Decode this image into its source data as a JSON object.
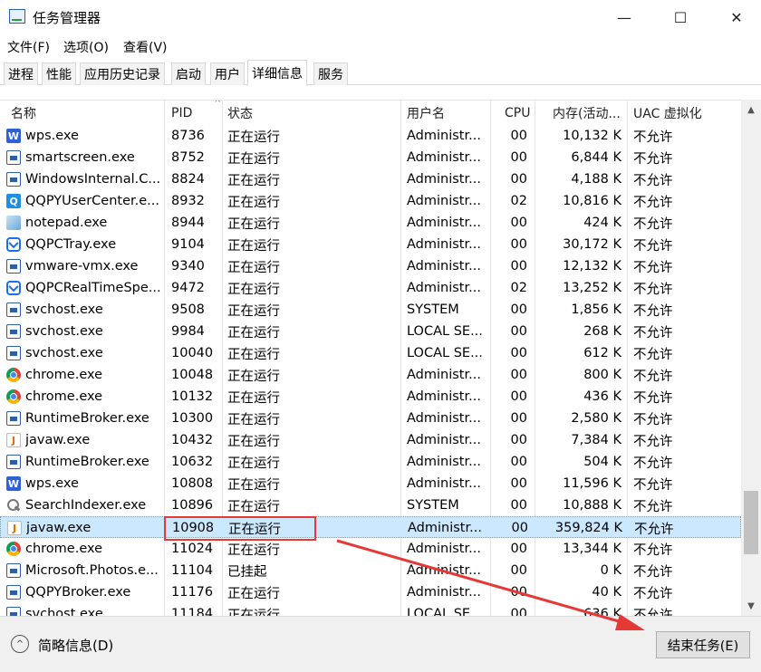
{
  "window": {
    "title": "任务管理器",
    "min": "—",
    "max": "☐",
    "close": "✕"
  },
  "menu": [
    "文件(F)",
    "选项(O)",
    "查看(V)"
  ],
  "tabs": [
    "进程",
    "性能",
    "应用历史记录",
    "启动",
    "用户",
    "详细信息",
    "服务"
  ],
  "active_tab": "详细信息",
  "columns": {
    "name": "名称",
    "pid": "PID",
    "status": "状态",
    "user": "用户名",
    "cpu": "CPU",
    "mem": "内存(活动...",
    "uac": "UAC 虚拟化"
  },
  "sort_arrow": "^",
  "rows": [
    {
      "icon": "wps-icon",
      "glyph": "W",
      "name": "wps.exe",
      "pid": "8736",
      "status": "正在运行",
      "user": "Administr...",
      "cpu": "00",
      "mem": "10,132 K",
      "uac": "不允许"
    },
    {
      "icon": "app-window-icon",
      "glyph": "",
      "name": "smartscreen.exe",
      "pid": "8752",
      "status": "正在运行",
      "user": "Administr...",
      "cpu": "00",
      "mem": "6,844 K",
      "uac": "不允许"
    },
    {
      "icon": "app-window-icon",
      "glyph": "",
      "name": "WindowsInternal.C...",
      "pid": "8824",
      "status": "正在运行",
      "user": "Administr...",
      "cpu": "00",
      "mem": "4,188 K",
      "uac": "不允许"
    },
    {
      "icon": "qq-pinyin-icon",
      "glyph": "Q",
      "name": "QQPYUserCenter.e...",
      "pid": "8932",
      "status": "正在运行",
      "user": "Administr...",
      "cpu": "02",
      "mem": "10,816 K",
      "uac": "不允许"
    },
    {
      "icon": "notepad-icon",
      "glyph": "",
      "name": "notepad.exe",
      "pid": "8944",
      "status": "正在运行",
      "user": "Administr...",
      "cpu": "00",
      "mem": "424 K",
      "uac": "不允许"
    },
    {
      "icon": "qqpc-shield-icon",
      "glyph": "",
      "name": "QQPCTray.exe",
      "pid": "9104",
      "status": "正在运行",
      "user": "Administr...",
      "cpu": "00",
      "mem": "30,172 K",
      "uac": "不允许"
    },
    {
      "icon": "app-window-icon",
      "glyph": "",
      "name": "vmware-vmx.exe",
      "pid": "9340",
      "status": "正在运行",
      "user": "Administr...",
      "cpu": "00",
      "mem": "12,132 K",
      "uac": "不允许"
    },
    {
      "icon": "qqpc-shield-icon",
      "glyph": "",
      "name": "QQPCRealTimeSpe...",
      "pid": "9472",
      "status": "正在运行",
      "user": "Administr...",
      "cpu": "02",
      "mem": "13,252 K",
      "uac": "不允许"
    },
    {
      "icon": "app-window-icon",
      "glyph": "",
      "name": "svchost.exe",
      "pid": "9508",
      "status": "正在运行",
      "user": "SYSTEM",
      "cpu": "00",
      "mem": "1,856 K",
      "uac": "不允许"
    },
    {
      "icon": "app-window-icon",
      "glyph": "",
      "name": "svchost.exe",
      "pid": "9984",
      "status": "正在运行",
      "user": "LOCAL SE...",
      "cpu": "00",
      "mem": "268 K",
      "uac": "不允许"
    },
    {
      "icon": "app-window-icon",
      "glyph": "",
      "name": "svchost.exe",
      "pid": "10040",
      "status": "正在运行",
      "user": "LOCAL SE...",
      "cpu": "00",
      "mem": "612 K",
      "uac": "不允许"
    },
    {
      "icon": "chrome-icon",
      "glyph": "",
      "name": "chrome.exe",
      "pid": "10048",
      "status": "正在运行",
      "user": "Administr...",
      "cpu": "00",
      "mem": "800 K",
      "uac": "不允许"
    },
    {
      "icon": "chrome-icon",
      "glyph": "",
      "name": "chrome.exe",
      "pid": "10132",
      "status": "正在运行",
      "user": "Administr...",
      "cpu": "00",
      "mem": "436 K",
      "uac": "不允许"
    },
    {
      "icon": "app-window-icon",
      "glyph": "",
      "name": "RuntimeBroker.exe",
      "pid": "10300",
      "status": "正在运行",
      "user": "Administr...",
      "cpu": "00",
      "mem": "2,580 K",
      "uac": "不允许"
    },
    {
      "icon": "java-icon",
      "glyph": "J",
      "name": "javaw.exe",
      "pid": "10432",
      "status": "正在运行",
      "user": "Administr...",
      "cpu": "00",
      "mem": "7,384 K",
      "uac": "不允许"
    },
    {
      "icon": "app-window-icon",
      "glyph": "",
      "name": "RuntimeBroker.exe",
      "pid": "10632",
      "status": "正在运行",
      "user": "Administr...",
      "cpu": "00",
      "mem": "504 K",
      "uac": "不允许"
    },
    {
      "icon": "wps-icon",
      "glyph": "W",
      "name": "wps.exe",
      "pid": "10808",
      "status": "正在运行",
      "user": "Administr...",
      "cpu": "00",
      "mem": "11,596 K",
      "uac": "不允许"
    },
    {
      "icon": "search-indexer-icon",
      "glyph": "",
      "name": "SearchIndexer.exe",
      "pid": "10896",
      "status": "正在运行",
      "user": "SYSTEM",
      "cpu": "00",
      "mem": "10,888 K",
      "uac": "不允许"
    },
    {
      "icon": "java-icon",
      "glyph": "J",
      "name": "javaw.exe",
      "pid": "10908",
      "status": "正在运行",
      "user": "Administr...",
      "cpu": "00",
      "mem": "359,824 K",
      "uac": "不允许",
      "selected": true
    },
    {
      "icon": "chrome-icon",
      "glyph": "",
      "name": "chrome.exe",
      "pid": "11024",
      "status": "正在运行",
      "user": "Administr...",
      "cpu": "00",
      "mem": "13,344 K",
      "uac": "不允许"
    },
    {
      "icon": "app-window-icon",
      "glyph": "",
      "name": "Microsoft.Photos.e...",
      "pid": "11104",
      "status": "已挂起",
      "user": "Administr...",
      "cpu": "00",
      "mem": "0 K",
      "uac": "不允许"
    },
    {
      "icon": "app-window-icon",
      "glyph": "",
      "name": "QQPYBroker.exe",
      "pid": "11176",
      "status": "正在运行",
      "user": "Administr...",
      "cpu": "00",
      "mem": "40 K",
      "uac": "不允许"
    },
    {
      "icon": "app-window-icon",
      "glyph": "",
      "name": "svchost.exe",
      "pid": "11184",
      "status": "正在运行",
      "user": "LOCAL SE...",
      "cpu": "00",
      "mem": "636 K",
      "uac": "不允许"
    }
  ],
  "footer": {
    "fewer_details": "简略信息(D)",
    "fewer_icon": "^",
    "end_task": "结束任务(E)"
  },
  "scrollbar": {
    "up": "▲",
    "down": "▼"
  },
  "annotation_color": "#e53935"
}
